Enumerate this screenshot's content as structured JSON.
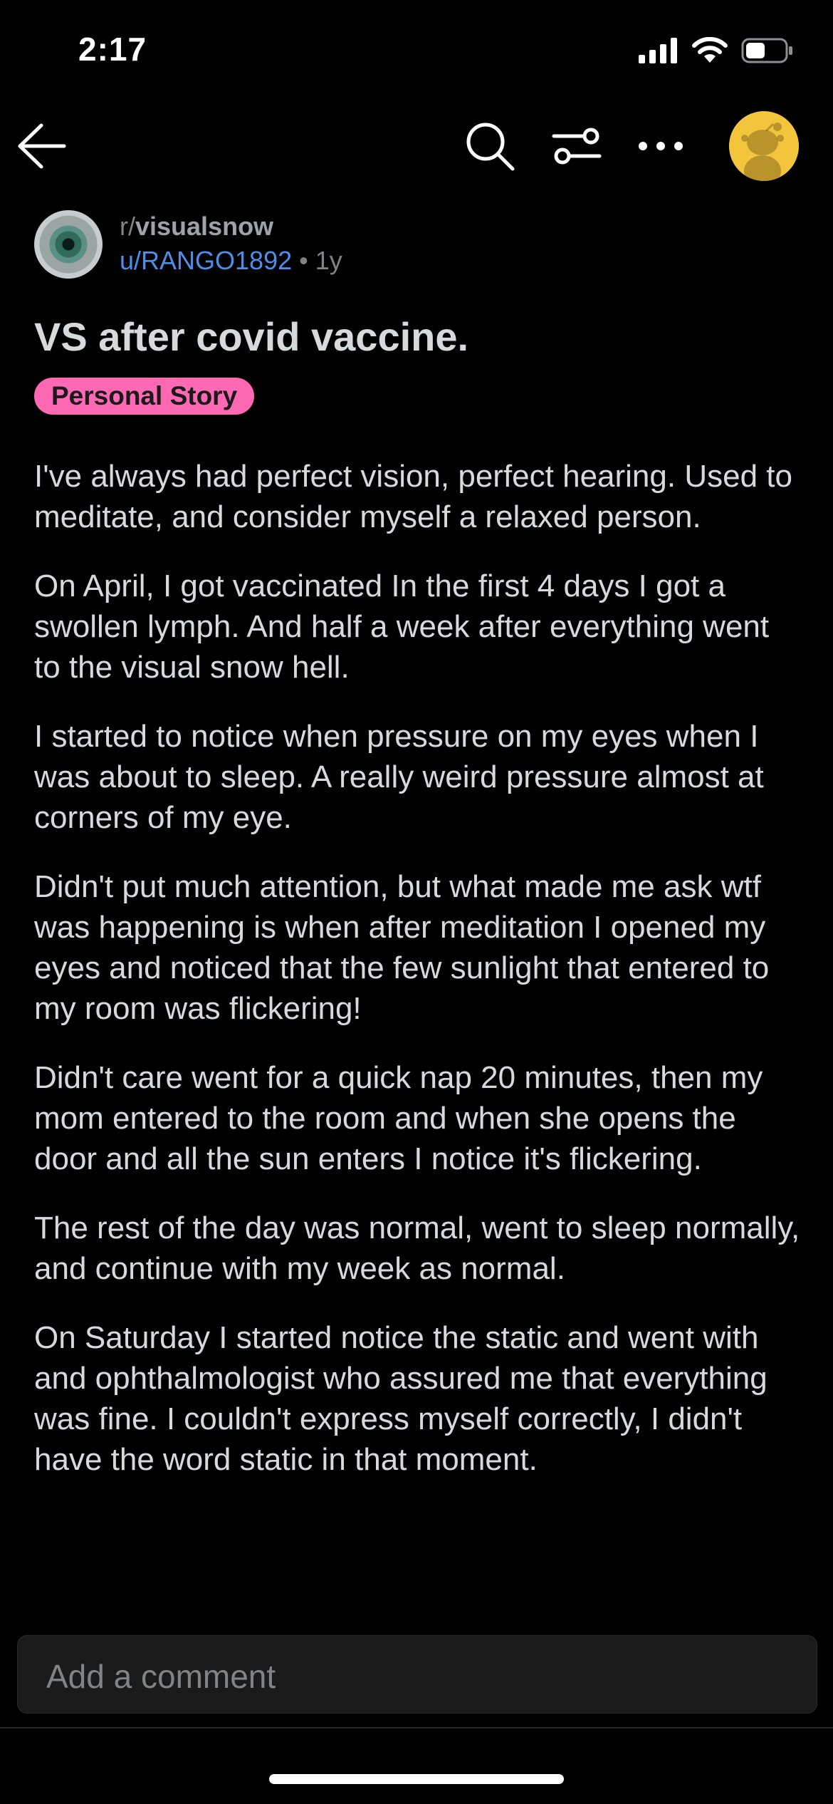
{
  "status_bar": {
    "time": "2:17",
    "icons": [
      "cellular-signal-icon",
      "wifi-icon",
      "battery-icon"
    ]
  },
  "toolbar": {
    "icons": [
      "back-arrow-icon",
      "search-icon",
      "filter-icon",
      "more-icon",
      "snoo-avatar-icon"
    ]
  },
  "post": {
    "subreddit_prefix": "r/",
    "subreddit_name": "visualsnow",
    "username": "u/RANGO1892",
    "separator": "•",
    "age": "1y",
    "title": "VS after covid vaccine.",
    "flair": "Personal Story",
    "paragraphs": [
      "I've always had perfect vision, perfect hearing. Used to meditate, and consider myself a relaxed person.",
      "On April, I got vaccinated In the first 4 days I got a swollen lymph. And  half a week after everything went to the visual snow hell.",
      "I started to notice when pressure on my eyes when I was about to sleep. A really weird pressure almost at corners of my eye.",
      "Didn't put much attention, but what made me ask wtf was happening is when after meditation I opened my eyes and noticed that the few sunlight that entered to my room was flickering!",
      "Didn't care went for a quick nap 20 minutes, then my mom entered to the room and when  she opens the door and all the sun enters I notice it's flickering.",
      "The rest of the day was normal, went to sleep normally, and continue with my week as normal.",
      "On Saturday I started notice the static and went with and ophthalmologist who assured me that everything was fine. I couldn't express myself correctly, I didn't have the word static in that moment."
    ]
  },
  "comment_bar": {
    "placeholder": "Add a comment"
  },
  "colors": {
    "background": "#000000",
    "text": "#d7dadc",
    "muted": "#818384",
    "username": "#4d8fe8",
    "flair_bg": "#ff69b4",
    "avatar_bg": "#f2c53d"
  }
}
